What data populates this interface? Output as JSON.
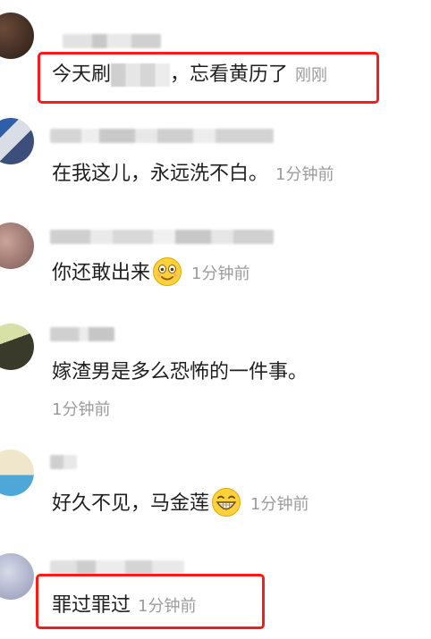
{
  "comments": [
    {
      "text_prefix": "今天刷",
      "text_suffix": "，忘看黄历了",
      "time": "刚刚",
      "highlighted": true
    },
    {
      "text": "在我这儿，永远洗不白。",
      "time": "1分钟前",
      "highlighted": false
    },
    {
      "text": "你还敢出来",
      "emoji": "smiling-face-icon",
      "time": "1分钟前",
      "highlighted": false
    },
    {
      "text": "嫁渣男是多么恐怖的一件事。",
      "time": "1分钟前",
      "highlighted": false
    },
    {
      "text": "好久不见，马金莲",
      "emoji": "grinning-face-icon",
      "time": "1分钟前",
      "highlighted": false
    },
    {
      "text": "罪过罪过",
      "time": "1分钟前",
      "highlighted": true
    }
  ],
  "colors": {
    "highlight_border": "#ff1a1a",
    "timestamp": "#9b9b9b",
    "text": "#1f1f1f"
  }
}
